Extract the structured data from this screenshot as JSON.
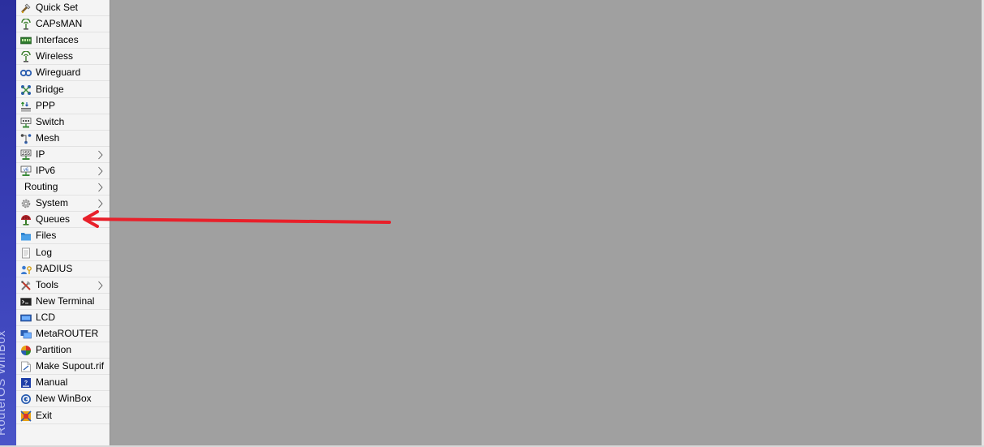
{
  "brand": {
    "text": "RouterOS WinBox"
  },
  "menu": {
    "items": [
      {
        "label": "Quick Set",
        "icon": "quick-set-icon",
        "submenu": false
      },
      {
        "label": "CAPsMAN",
        "icon": "capsman-antenna-icon",
        "submenu": false
      },
      {
        "label": "Interfaces",
        "icon": "interfaces-icon",
        "submenu": false
      },
      {
        "label": "Wireless",
        "icon": "wireless-antenna-icon",
        "submenu": false
      },
      {
        "label": "Wireguard",
        "icon": "wireguard-icon",
        "submenu": false
      },
      {
        "label": "Bridge",
        "icon": "bridge-icon",
        "submenu": false
      },
      {
        "label": "PPP",
        "icon": "ppp-icon",
        "submenu": false
      },
      {
        "label": "Switch",
        "icon": "switch-icon",
        "submenu": false
      },
      {
        "label": "Mesh",
        "icon": "mesh-icon",
        "submenu": false
      },
      {
        "label": "IP",
        "icon": "ip-icon",
        "submenu": true
      },
      {
        "label": "IPv6",
        "icon": "ipv6-icon",
        "submenu": true
      },
      {
        "label": "Routing",
        "icon": "",
        "submenu": true
      },
      {
        "label": "System",
        "icon": "system-gear-icon",
        "submenu": true
      },
      {
        "label": "Queues",
        "icon": "queues-icon",
        "submenu": false
      },
      {
        "label": "Files",
        "icon": "files-folder-icon",
        "submenu": false
      },
      {
        "label": "Log",
        "icon": "log-icon",
        "submenu": false
      },
      {
        "label": "RADIUS",
        "icon": "radius-icon",
        "submenu": false
      },
      {
        "label": "Tools",
        "icon": "tools-icon",
        "submenu": true
      },
      {
        "label": "New Terminal",
        "icon": "terminal-icon",
        "submenu": false
      },
      {
        "label": "LCD",
        "icon": "lcd-icon",
        "submenu": false
      },
      {
        "label": "MetaROUTER",
        "icon": "metarouter-icon",
        "submenu": false
      },
      {
        "label": "Partition",
        "icon": "partition-icon",
        "submenu": false
      },
      {
        "label": "Make Supout.rif",
        "icon": "supout-icon",
        "submenu": false
      },
      {
        "label": "Manual",
        "icon": "manual-icon",
        "submenu": false
      },
      {
        "label": "New WinBox",
        "icon": "new-winbox-icon",
        "submenu": false
      },
      {
        "label": "Exit",
        "icon": "exit-icon",
        "submenu": false
      }
    ]
  },
  "colors": {
    "brand_strip": "#2b2f9e",
    "workspace": "#a0a0a0",
    "annotation_arrow": "#e8202a"
  },
  "annotation": {
    "points_to": "Queues"
  }
}
